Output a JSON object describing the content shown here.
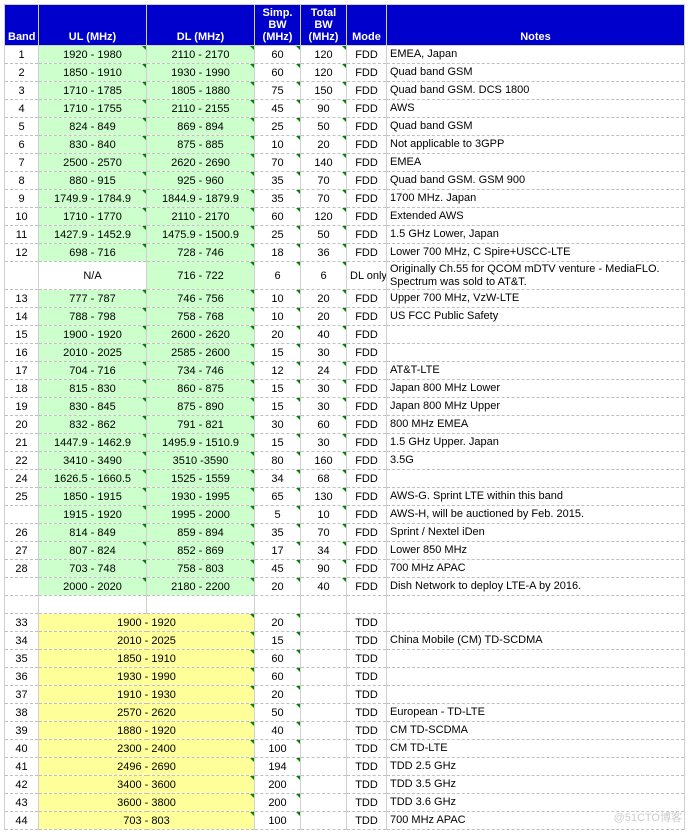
{
  "headers": {
    "band": "Band",
    "ul": "UL (MHz)",
    "dl": "DL (MHz)",
    "sbw": "Simp. BW (MHz)",
    "tbw": "Total BW (MHz)",
    "mode": "Mode",
    "notes": "Notes"
  },
  "chart_data": {
    "type": "table",
    "title": "LTE Band Table",
    "rows": [
      {
        "band": "1",
        "ul": "1920 - 1980",
        "dl": "2110 - 2170",
        "color": "green",
        "sbw": "60",
        "tbw": "120",
        "mode": "FDD",
        "notes": "EMEA, Japan"
      },
      {
        "band": "2",
        "ul": "1850 - 1910",
        "dl": "1930 - 1990",
        "color": "green",
        "sbw": "60",
        "tbw": "120",
        "mode": "FDD",
        "notes": "Quad band GSM"
      },
      {
        "band": "3",
        "ul": "1710 - 1785",
        "dl": "1805 - 1880",
        "color": "green",
        "sbw": "75",
        "tbw": "150",
        "mode": "FDD",
        "notes": "Quad band GSM. DCS 1800"
      },
      {
        "band": "4",
        "ul": "1710 - 1755",
        "dl": "2110 - 2155",
        "color": "green",
        "sbw": "45",
        "tbw": "90",
        "mode": "FDD",
        "notes": "AWS"
      },
      {
        "band": "5",
        "ul": "824 - 849",
        "dl": "869 - 894",
        "color": "green",
        "sbw": "25",
        "tbw": "50",
        "mode": "FDD",
        "notes": "Quad band GSM"
      },
      {
        "band": "6",
        "ul": "830 - 840",
        "dl": "875 - 885",
        "color": "green",
        "sbw": "10",
        "tbw": "20",
        "mode": "FDD",
        "notes": "Not applicable to 3GPP"
      },
      {
        "band": "7",
        "ul": "2500 - 2570",
        "dl": "2620 - 2690",
        "color": "green",
        "sbw": "70",
        "tbw": "140",
        "mode": "FDD",
        "notes": "EMEA"
      },
      {
        "band": "8",
        "ul": "880 - 915",
        "dl": "925 - 960",
        "color": "green",
        "sbw": "35",
        "tbw": "70",
        "mode": "FDD",
        "notes": "Quad band GSM. GSM 900"
      },
      {
        "band": "9",
        "ul": "1749.9 - 1784.9",
        "dl": "1844.9 - 1879.9",
        "color": "green",
        "sbw": "35",
        "tbw": "70",
        "mode": "FDD",
        "notes": "1700 MHz. Japan"
      },
      {
        "band": "10",
        "ul": "1710 - 1770",
        "dl": "2110 - 2170",
        "color": "green",
        "sbw": "60",
        "tbw": "120",
        "mode": "FDD",
        "notes": "Extended AWS"
      },
      {
        "band": "11",
        "ul": "1427.9 - 1452.9",
        "dl": "1475.9 - 1500.9",
        "color": "green",
        "sbw": "25",
        "tbw": "50",
        "mode": "FDD",
        "notes": "1.5 GHz Lower, Japan"
      },
      {
        "band": "12",
        "ul": "698 - 716",
        "dl": "728 - 746",
        "color": "green",
        "sbw": "18",
        "tbw": "36",
        "mode": "FDD",
        "notes": "Lower 700 MHz, C Spire+USCC-LTE"
      },
      {
        "band": "",
        "ul": "N/A",
        "dl": "716 - 722",
        "color": "green",
        "sbw": "6",
        "tbw": "6",
        "mode": "DL only",
        "notes": "Originally Ch.55 for QCOM mDTV venture - MediaFLO.  Spectrum was sold to AT&T.",
        "ulColor": "none"
      },
      {
        "band": "13",
        "ul": "777 - 787",
        "dl": "746 - 756",
        "color": "green",
        "sbw": "10",
        "tbw": "20",
        "mode": "FDD",
        "notes": "Upper 700 MHz, VzW-LTE"
      },
      {
        "band": "14",
        "ul": "788 - 798",
        "dl": "758 - 768",
        "color": "green",
        "sbw": "10",
        "tbw": "20",
        "mode": "FDD",
        "notes": "US FCC Public Safety"
      },
      {
        "band": "15",
        "ul": "1900 - 1920",
        "dl": "2600 - 2620",
        "color": "green",
        "sbw": "20",
        "tbw": "40",
        "mode": "FDD",
        "notes": ""
      },
      {
        "band": "16",
        "ul": "2010 - 2025",
        "dl": "2585 - 2600",
        "color": "green",
        "sbw": "15",
        "tbw": "30",
        "mode": "FDD",
        "notes": ""
      },
      {
        "band": "17",
        "ul": "704 - 716",
        "dl": "734 - 746",
        "color": "green",
        "sbw": "12",
        "tbw": "24",
        "mode": "FDD",
        "notes": "AT&T-LTE"
      },
      {
        "band": "18",
        "ul": "815 - 830",
        "dl": "860 - 875",
        "color": "green",
        "sbw": "15",
        "tbw": "30",
        "mode": "FDD",
        "notes": "Japan 800 MHz Lower"
      },
      {
        "band": "19",
        "ul": "830 - 845",
        "dl": "875 - 890",
        "color": "green",
        "sbw": "15",
        "tbw": "30",
        "mode": "FDD",
        "notes": "Japan 800 MHz Upper"
      },
      {
        "band": "20",
        "ul": "832 - 862",
        "dl": "791 - 821",
        "color": "green",
        "sbw": "30",
        "tbw": "60",
        "mode": "FDD",
        "notes": "800 MHz EMEA"
      },
      {
        "band": "21",
        "ul": "1447.9 - 1462.9",
        "dl": "1495.9 - 1510.9",
        "color": "green",
        "sbw": "15",
        "tbw": "30",
        "mode": "FDD",
        "notes": "1.5 GHz Upper. Japan"
      },
      {
        "band": "22",
        "ul": "3410 - 3490",
        "dl": "3510 -3590",
        "color": "green",
        "sbw": "80",
        "tbw": "160",
        "mode": "FDD",
        "notes": "3.5G"
      },
      {
        "band": "24",
        "ul": "1626.5 - 1660.5",
        "dl": "1525 - 1559",
        "color": "green",
        "sbw": "34",
        "tbw": "68",
        "mode": "FDD",
        "notes": ""
      },
      {
        "band": "25",
        "ul": "1850 - 1915",
        "dl": "1930 - 1995",
        "color": "green",
        "sbw": "65",
        "tbw": "130",
        "mode": "FDD",
        "notes": "AWS-G. Sprint LTE within this band"
      },
      {
        "band": "",
        "ul": "1915 - 1920",
        "dl": "1995 - 2000",
        "color": "green",
        "sbw": "5",
        "tbw": "10",
        "mode": "FDD",
        "notes": "AWS-H, will be auctioned by Feb. 2015."
      },
      {
        "band": "26",
        "ul": "814 - 849",
        "dl": "859 - 894",
        "color": "green",
        "sbw": "35",
        "tbw": "70",
        "mode": "FDD",
        "notes": "Sprint / Nextel iDen"
      },
      {
        "band": "27",
        "ul": "807 - 824",
        "dl": "852 - 869",
        "color": "green",
        "sbw": "17",
        "tbw": "34",
        "mode": "FDD",
        "notes": "Lower 850 MHz"
      },
      {
        "band": "28",
        "ul": "703 - 748",
        "dl": "758 - 803",
        "color": "green",
        "sbw": "45",
        "tbw": "90",
        "mode": "FDD",
        "notes": "700 MHz APAC"
      },
      {
        "band": "",
        "ul": "2000 - 2020",
        "dl": "2180 - 2200",
        "color": "green",
        "sbw": "20",
        "tbw": "40",
        "mode": "FDD",
        "notes": "Dish Network to deploy LTE-A by 2016."
      },
      {
        "blank": true
      },
      {
        "band": "33",
        "merged": "1900 - 1920",
        "color": "yellow",
        "sbw": "20",
        "tbw": "",
        "mode": "TDD",
        "notes": ""
      },
      {
        "band": "34",
        "merged": "2010 - 2025",
        "color": "yellow",
        "sbw": "15",
        "tbw": "",
        "mode": "TDD",
        "notes": "China Mobile (CM) TD-SCDMA"
      },
      {
        "band": "35",
        "merged": "1850 - 1910",
        "color": "yellow",
        "sbw": "60",
        "tbw": "",
        "mode": "TDD",
        "notes": ""
      },
      {
        "band": "36",
        "merged": "1930 - 1990",
        "color": "yellow",
        "sbw": "60",
        "tbw": "",
        "mode": "TDD",
        "notes": ""
      },
      {
        "band": "37",
        "merged": "1910 - 1930",
        "color": "yellow",
        "sbw": "20",
        "tbw": "",
        "mode": "TDD",
        "notes": ""
      },
      {
        "band": "38",
        "merged": "2570 - 2620",
        "color": "yellow",
        "sbw": "50",
        "tbw": "",
        "mode": "TDD",
        "notes": "European - TD-LTE"
      },
      {
        "band": "39",
        "merged": "1880 - 1920",
        "color": "yellow",
        "sbw": "40",
        "tbw": "",
        "mode": "TDD",
        "notes": "CM TD-SCDMA"
      },
      {
        "band": "40",
        "merged": "2300 - 2400",
        "color": "yellow",
        "sbw": "100",
        "tbw": "",
        "mode": "TDD",
        "notes": "CM TD-LTE"
      },
      {
        "band": "41",
        "merged": "2496 - 2690",
        "color": "yellow",
        "sbw": "194",
        "tbw": "",
        "mode": "TDD",
        "notes": "TDD 2.5 GHz"
      },
      {
        "band": "42",
        "merged": "3400 - 3600",
        "color": "yellow",
        "sbw": "200",
        "tbw": "",
        "mode": "TDD",
        "notes": "TDD 3.5 GHz"
      },
      {
        "band": "43",
        "merged": "3600 - 3800",
        "color": "yellow",
        "sbw": "200",
        "tbw": "",
        "mode": "TDD",
        "notes": "TDD 3.6 GHz"
      },
      {
        "band": "44",
        "merged": "703 - 803",
        "color": "yellow",
        "sbw": "100",
        "tbw": "",
        "mode": "TDD",
        "notes": "700 MHz APAC"
      }
    ]
  },
  "watermark": "@51CTO博客"
}
